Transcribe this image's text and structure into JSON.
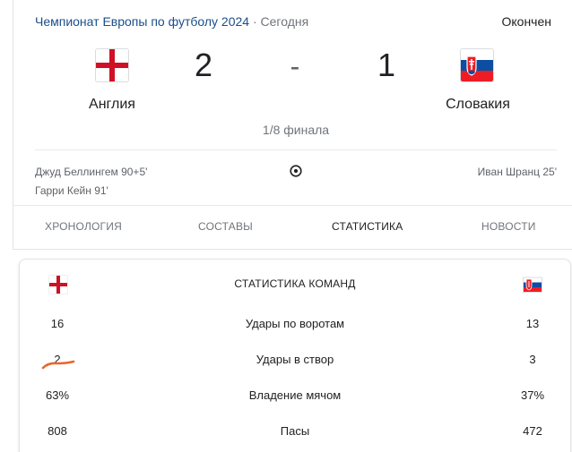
{
  "match": {
    "competition": "Чемпионат Европы по футболу 2024",
    "separator": "·",
    "date": "Сегодня",
    "status": "Окончен",
    "stage": "1/8 финала",
    "home": {
      "name": "Англия",
      "score": "2",
      "flag": "england-flag",
      "scorers": [
        "Джуд Беллингем 90+5'",
        "Гарри Кейн 91'"
      ]
    },
    "away": {
      "name": "Словакия",
      "score": "1",
      "flag": "slovakia-flag",
      "scorers": [
        "Иван Шранц 25'"
      ]
    },
    "score_separator": "-"
  },
  "tabs": [
    {
      "label": "ХРОНОЛОГИЯ",
      "active": false
    },
    {
      "label": "СОСТАВЫ",
      "active": false
    },
    {
      "label": "СТАТИСТИКА",
      "active": true
    },
    {
      "label": "НОВОСТИ",
      "active": false
    }
  ],
  "stats": {
    "title": "СТАТИСТИКА КОМАНД",
    "rows": [
      {
        "label": "Удары по воротам",
        "home": "16",
        "away": "13"
      },
      {
        "label": "Удары в створ",
        "home": "2",
        "away": "3"
      },
      {
        "label": "Владение мячом",
        "home": "63%",
        "away": "37%"
      },
      {
        "label": "Пасы",
        "home": "808",
        "away": "472"
      }
    ]
  },
  "colors": {
    "link": "#1a4e8a",
    "muted": "#70757a",
    "annotation": "#e8652a",
    "england_red": "#ce1124",
    "slovakia_blue": "#0b4ea2",
    "slovakia_red": "#ee1c25"
  }
}
